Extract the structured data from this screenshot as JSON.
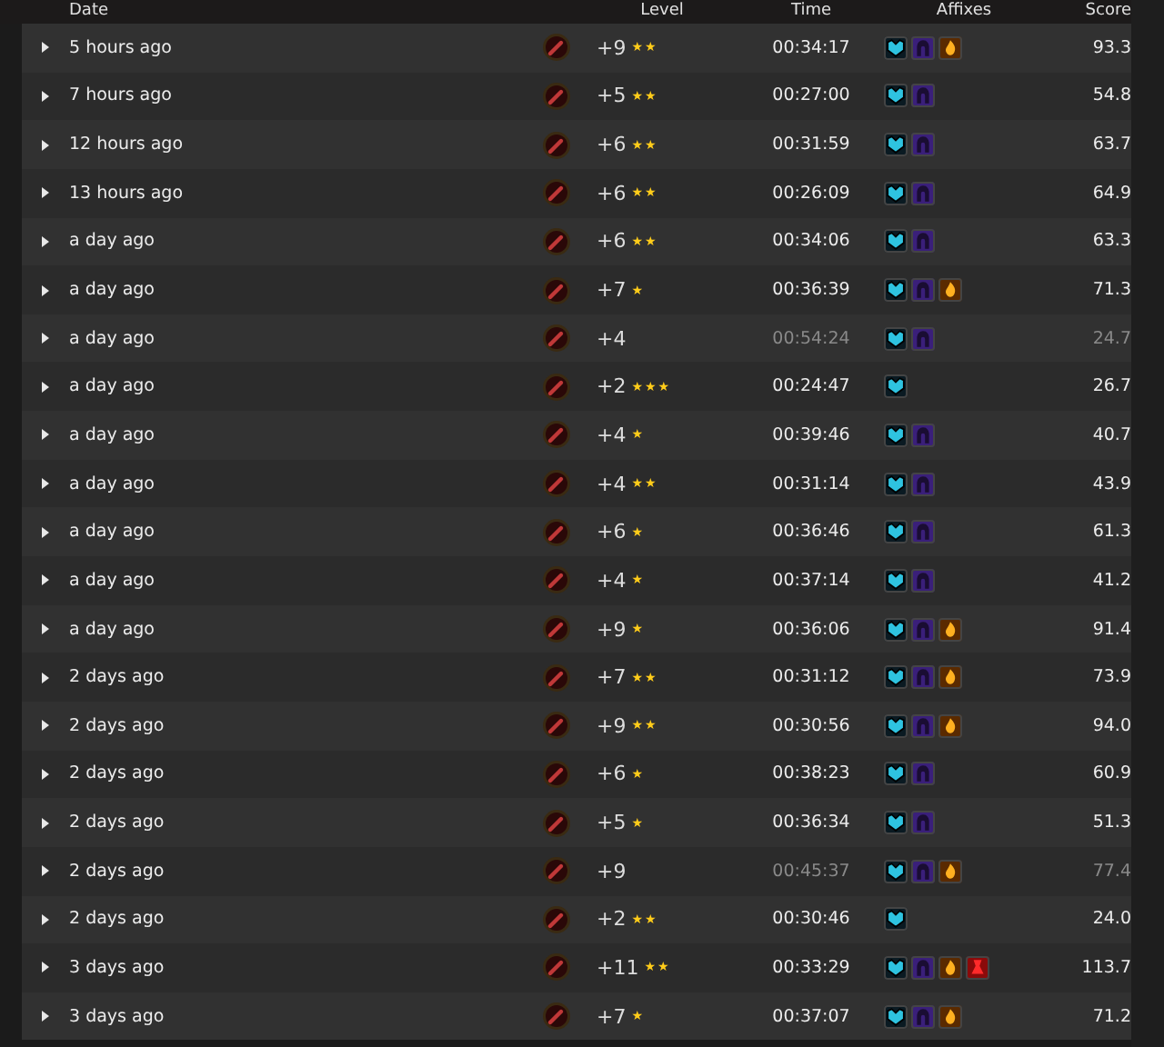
{
  "columns": [
    "Date",
    "Level",
    "Time",
    "Affixes",
    "Score"
  ],
  "rows": [
    {
      "date": "5 hours ago",
      "level": "+9",
      "upgrade_marks": "★★",
      "time": "00:34:17",
      "timed": true,
      "affixes": [
        {
          "kind": "shield"
        },
        {
          "kind": "void"
        },
        {
          "kind": "fire"
        }
      ],
      "score": "93.3"
    },
    {
      "date": "7 hours ago",
      "level": "+5",
      "upgrade_marks": "★★",
      "time": "00:27:00",
      "timed": true,
      "affixes": [
        {
          "kind": "shield"
        },
        {
          "kind": "void"
        }
      ],
      "score": "54.8"
    },
    {
      "date": "12 hours ago",
      "level": "+6",
      "upgrade_marks": "★★",
      "time": "00:31:59",
      "timed": true,
      "affixes": [
        {
          "kind": "shield"
        },
        {
          "kind": "void"
        }
      ],
      "score": "63.7"
    },
    {
      "date": "13 hours ago",
      "level": "+6",
      "upgrade_marks": "★★",
      "time": "00:26:09",
      "timed": true,
      "affixes": [
        {
          "kind": "shield"
        },
        {
          "kind": "void"
        }
      ],
      "score": "64.9"
    },
    {
      "date": "a day ago",
      "level": "+6",
      "upgrade_marks": "★★",
      "time": "00:34:06",
      "timed": true,
      "affixes": [
        {
          "kind": "shield"
        },
        {
          "kind": "void"
        }
      ],
      "score": "63.3"
    },
    {
      "date": "a day ago",
      "level": "+7",
      "upgrade_marks": "★",
      "time": "00:36:39",
      "timed": true,
      "affixes": [
        {
          "kind": "shield"
        },
        {
          "kind": "void"
        },
        {
          "kind": "fire"
        }
      ],
      "score": "71.3"
    },
    {
      "date": "a day ago",
      "level": "+4",
      "time": "00:54:24",
      "timed": false,
      "affixes": [
        {
          "kind": "shield"
        },
        {
          "kind": "void"
        }
      ],
      "score": "24.7"
    },
    {
      "date": "a day ago",
      "level": "+2",
      "upgrade_marks": "★★★",
      "time": "00:24:47",
      "timed": true,
      "affixes": [
        {
          "kind": "shield"
        }
      ],
      "score": "26.7"
    },
    {
      "date": "a day ago",
      "level": "+4",
      "upgrade_marks": "★",
      "time": "00:39:46",
      "timed": true,
      "affixes": [
        {
          "kind": "shield"
        },
        {
          "kind": "void"
        }
      ],
      "score": "40.7"
    },
    {
      "date": "a day ago",
      "level": "+4",
      "upgrade_marks": "★★",
      "time": "00:31:14",
      "timed": true,
      "affixes": [
        {
          "kind": "shield"
        },
        {
          "kind": "void"
        }
      ],
      "score": "43.9"
    },
    {
      "date": "a day ago",
      "level": "+6",
      "upgrade_marks": "★",
      "time": "00:36:46",
      "timed": true,
      "affixes": [
        {
          "kind": "shield"
        },
        {
          "kind": "void"
        }
      ],
      "score": "61.3"
    },
    {
      "date": "a day ago",
      "level": "+4",
      "upgrade_marks": "★",
      "time": "00:37:14",
      "timed": true,
      "affixes": [
        {
          "kind": "shield"
        },
        {
          "kind": "void"
        }
      ],
      "score": "41.2"
    },
    {
      "date": "a day ago",
      "level": "+9",
      "upgrade_marks": "★",
      "time": "00:36:06",
      "timed": true,
      "affixes": [
        {
          "kind": "shield"
        },
        {
          "kind": "void"
        },
        {
          "kind": "fire"
        }
      ],
      "score": "91.4"
    },
    {
      "date": "2 days ago",
      "level": "+7",
      "upgrade_marks": "★★",
      "time": "00:31:12",
      "timed": true,
      "affixes": [
        {
          "kind": "shield"
        },
        {
          "kind": "void"
        },
        {
          "kind": "fire"
        }
      ],
      "score": "73.9"
    },
    {
      "date": "2 days ago",
      "level": "+9",
      "upgrade_marks": "★★",
      "time": "00:30:56",
      "timed": true,
      "affixes": [
        {
          "kind": "shield"
        },
        {
          "kind": "void"
        },
        {
          "kind": "fire"
        }
      ],
      "score": "94.0"
    },
    {
      "date": "2 days ago",
      "level": "+6",
      "upgrade_marks": "★",
      "time": "00:38:23",
      "timed": true,
      "affixes": [
        {
          "kind": "shield"
        },
        {
          "kind": "void"
        }
      ],
      "score": "60.9"
    },
    {
      "date": "2 days ago",
      "level": "+5",
      "upgrade_marks": "★",
      "time": "00:36:34",
      "timed": true,
      "affixes": [
        {
          "kind": "shield"
        },
        {
          "kind": "void"
        }
      ],
      "score": "51.3"
    },
    {
      "date": "2 days ago",
      "level": "+9",
      "time": "00:45:37",
      "timed": false,
      "affixes": [
        {
          "kind": "shield"
        },
        {
          "kind": "void"
        },
        {
          "kind": "fire"
        }
      ],
      "score": "77.4"
    },
    {
      "date": "2 days ago",
      "level": "+2",
      "upgrade_marks": "★★",
      "time": "00:30:46",
      "timed": true,
      "affixes": [
        {
          "kind": "shield"
        }
      ],
      "score": "24.0"
    },
    {
      "date": "3 days ago",
      "level": "+11",
      "upgrade_marks": "★★",
      "time": "00:33:29",
      "timed": true,
      "affixes": [
        {
          "kind": "shield"
        },
        {
          "kind": "void"
        },
        {
          "kind": "fire"
        },
        {
          "kind": "blood"
        }
      ],
      "score": "113.7"
    },
    {
      "date": "3 days ago",
      "level": "+7",
      "upgrade_marks": "★",
      "time": "00:37:07",
      "timed": true,
      "affixes": [
        {
          "kind": "shield"
        },
        {
          "kind": "void"
        },
        {
          "kind": "fire"
        }
      ],
      "score": "71.2"
    }
  ]
}
